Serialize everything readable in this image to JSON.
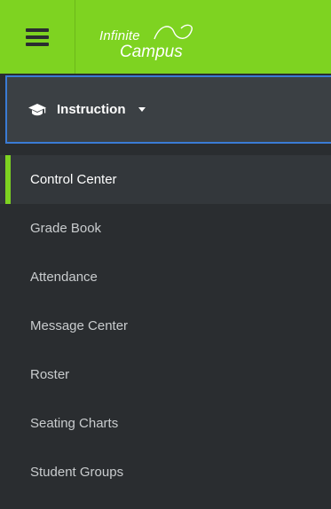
{
  "app": {
    "logo_line1": "Infinite",
    "logo_line2": "Campus",
    "menu_icon": "hamburger-icon",
    "brand_color": "#7ed321"
  },
  "product_switcher": {
    "icon": "graduation-cap-icon",
    "label": "Instruction",
    "caret_icon": "caret-down-icon"
  },
  "nav": {
    "items": [
      {
        "label": "Control Center",
        "active": true
      },
      {
        "label": "Grade Book",
        "active": false
      },
      {
        "label": "Attendance",
        "active": false
      },
      {
        "label": "Message Center",
        "active": false
      },
      {
        "label": "Roster",
        "active": false
      },
      {
        "label": "Seating Charts",
        "active": false
      },
      {
        "label": "Student Groups",
        "active": false
      }
    ]
  }
}
